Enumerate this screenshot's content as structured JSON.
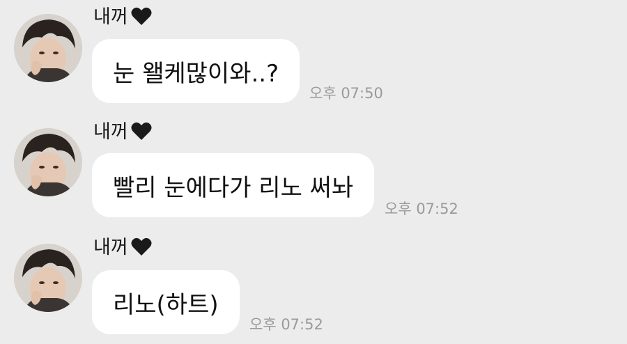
{
  "messages": [
    {
      "sender": "내꺼",
      "text": "눈 왤케많이와..?",
      "time": "오후 07:50"
    },
    {
      "sender": "내꺼",
      "text": "빨리 눈에다가 리노 써놔",
      "time": "오후 07:52"
    },
    {
      "sender": "내꺼",
      "text": "리노(하트)",
      "time": "오후 07:52"
    }
  ],
  "colors": {
    "background": "#ececec",
    "bubble": "#ffffff",
    "time_text": "#9a9a9a",
    "heart": "#1a1a1a"
  },
  "icons": {
    "sender_heart": "black-heart-icon"
  }
}
